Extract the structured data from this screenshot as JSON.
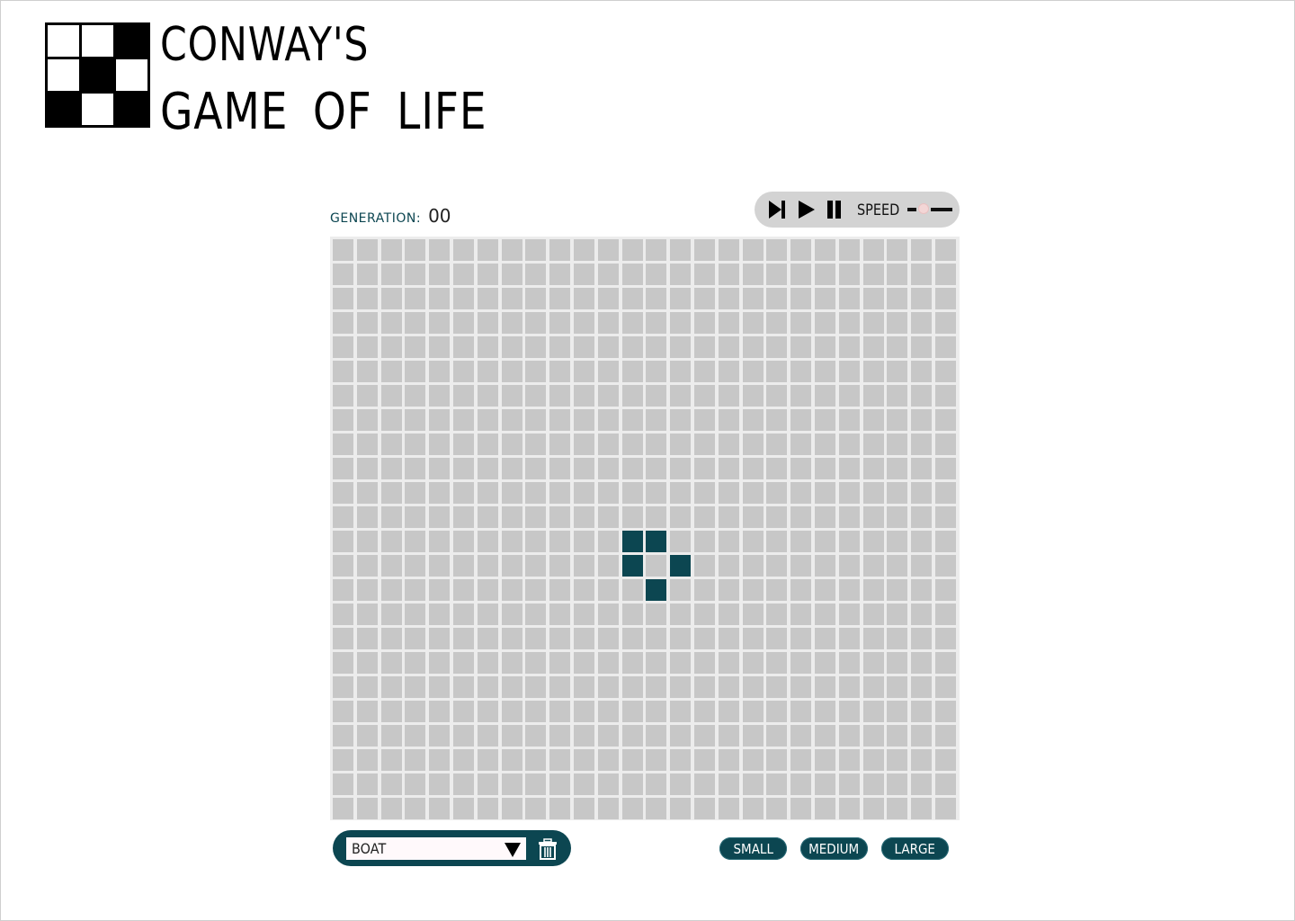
{
  "app": {
    "title_line1": "CONWAY'S",
    "title_line2": "GAME OF LIFE"
  },
  "logo": {
    "pattern": [
      0,
      0,
      1,
      0,
      1,
      0,
      1,
      0,
      1
    ]
  },
  "generation": {
    "label": "GENERATION:",
    "value": "00"
  },
  "controls": {
    "step_icon": "step-forward-icon",
    "play_icon": "play-icon",
    "pause_icon": "pause-icon",
    "speed_label": "SPEED",
    "speed_value": 0.35
  },
  "board": {
    "columns": 26,
    "rows": 24,
    "alive_cells": [
      [
        12,
        12
      ],
      [
        12,
        13
      ],
      [
        13,
        12
      ],
      [
        13,
        14
      ],
      [
        14,
        13
      ]
    ]
  },
  "pattern_picker": {
    "selected": "BOAT",
    "delete_icon": "trash-icon"
  },
  "board_sizes": {
    "small": "SMALL",
    "medium": "MEDIUM",
    "large": "LARGE"
  },
  "colors": {
    "accent": "#0c4651",
    "dead_cell": "#c7c7c7",
    "board_bg": "#ececec",
    "controls_bg": "#d3d3d3"
  }
}
